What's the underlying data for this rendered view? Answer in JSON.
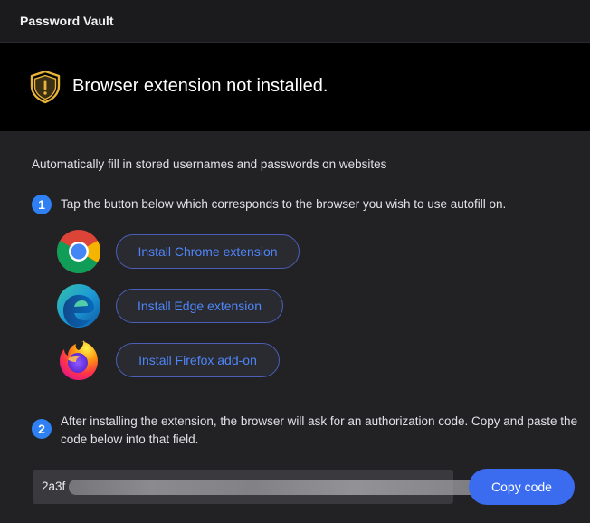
{
  "window": {
    "title": "Password Vault"
  },
  "banner": {
    "message": "Browser extension not installed.",
    "icon": "warning-shield-icon"
  },
  "description": "Automatically fill in stored usernames and passwords on websites",
  "steps": [
    {
      "number": "1",
      "text": "Tap the button below which corresponds to the browser you wish to use autofill on."
    },
    {
      "number": "2",
      "text": "After installing the extension, the browser will ask for an authorization code. Copy and paste the code below into that field."
    }
  ],
  "browsers": [
    {
      "name": "chrome",
      "icon": "chrome-icon",
      "label": "Install Chrome extension"
    },
    {
      "name": "edge",
      "icon": "edge-icon",
      "label": "Install Edge extension"
    },
    {
      "name": "firefox",
      "icon": "firefox-icon",
      "label": "Install Firefox add-on"
    }
  ],
  "auth_code": {
    "visible_prefix": "2a3f"
  },
  "copy_button": {
    "label": "Copy code"
  },
  "colors": {
    "accent": "#3b6cf0",
    "warning": "#e8b33a",
    "link_text": "#4f86f7"
  }
}
